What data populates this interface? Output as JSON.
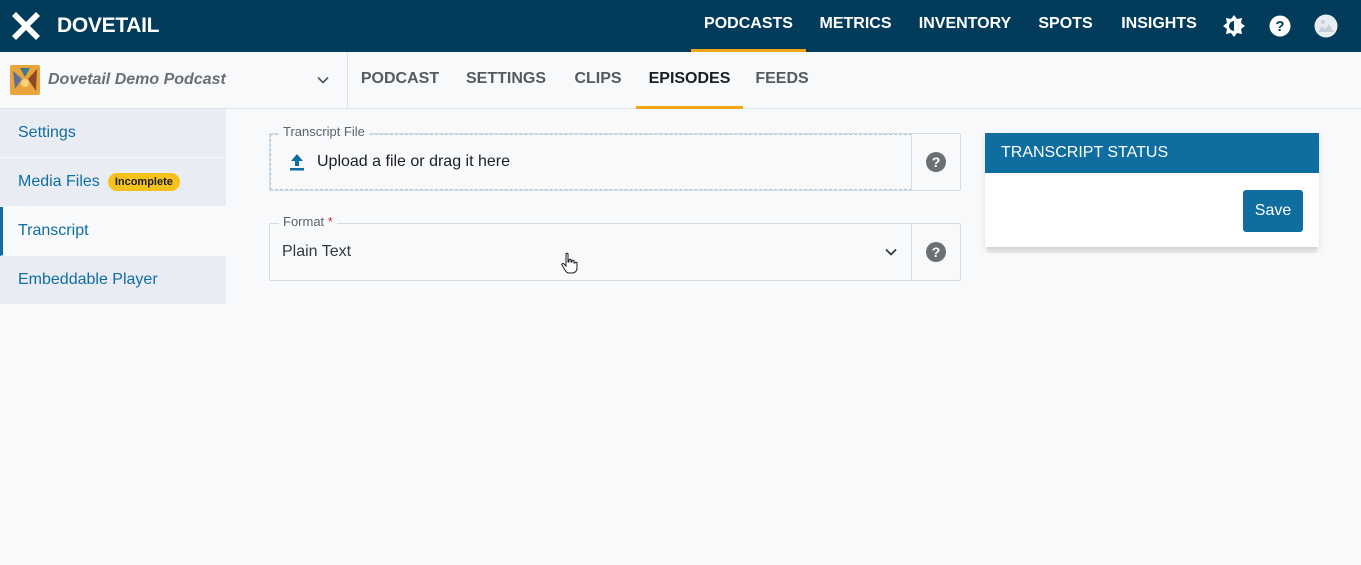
{
  "brand": {
    "name": "DOVETAIL"
  },
  "topnav": {
    "items": [
      {
        "label": "PODCASTS",
        "active": true
      },
      {
        "label": "METRICS",
        "active": false
      },
      {
        "label": "INVENTORY",
        "active": false
      },
      {
        "label": "SPOTS",
        "active": false
      },
      {
        "label": "INSIGHTS",
        "active": false
      }
    ],
    "icons": [
      "brightness-icon",
      "help-icon",
      "avatar"
    ]
  },
  "podcast_selector": {
    "name": "Dovetail Demo Podcast"
  },
  "tabs": [
    {
      "label": "PODCAST",
      "active": false
    },
    {
      "label": "SETTINGS",
      "active": false
    },
    {
      "label": "CLIPS",
      "active": false
    },
    {
      "label": "EPISODES",
      "active": true
    },
    {
      "label": "FEEDS",
      "active": false
    }
  ],
  "sidebar": {
    "items": [
      {
        "label": "Settings"
      },
      {
        "label": "Media Files",
        "badge": "Incomplete"
      },
      {
        "label": "Transcript",
        "active": true
      },
      {
        "label": "Embeddable Player"
      }
    ]
  },
  "transcript_file": {
    "label": "Transcript File",
    "upload_text": "Upload a file or drag it here"
  },
  "format": {
    "label": "Format",
    "required_mark": "*",
    "value": "Plain Text"
  },
  "status_card": {
    "title": "TRANSCRIPT STATUS",
    "save_label": "Save"
  },
  "colors": {
    "nav_bg": "#033c5a",
    "accent": "#f2a516",
    "primary": "#0f6da0",
    "badge": "#f7c21e"
  }
}
